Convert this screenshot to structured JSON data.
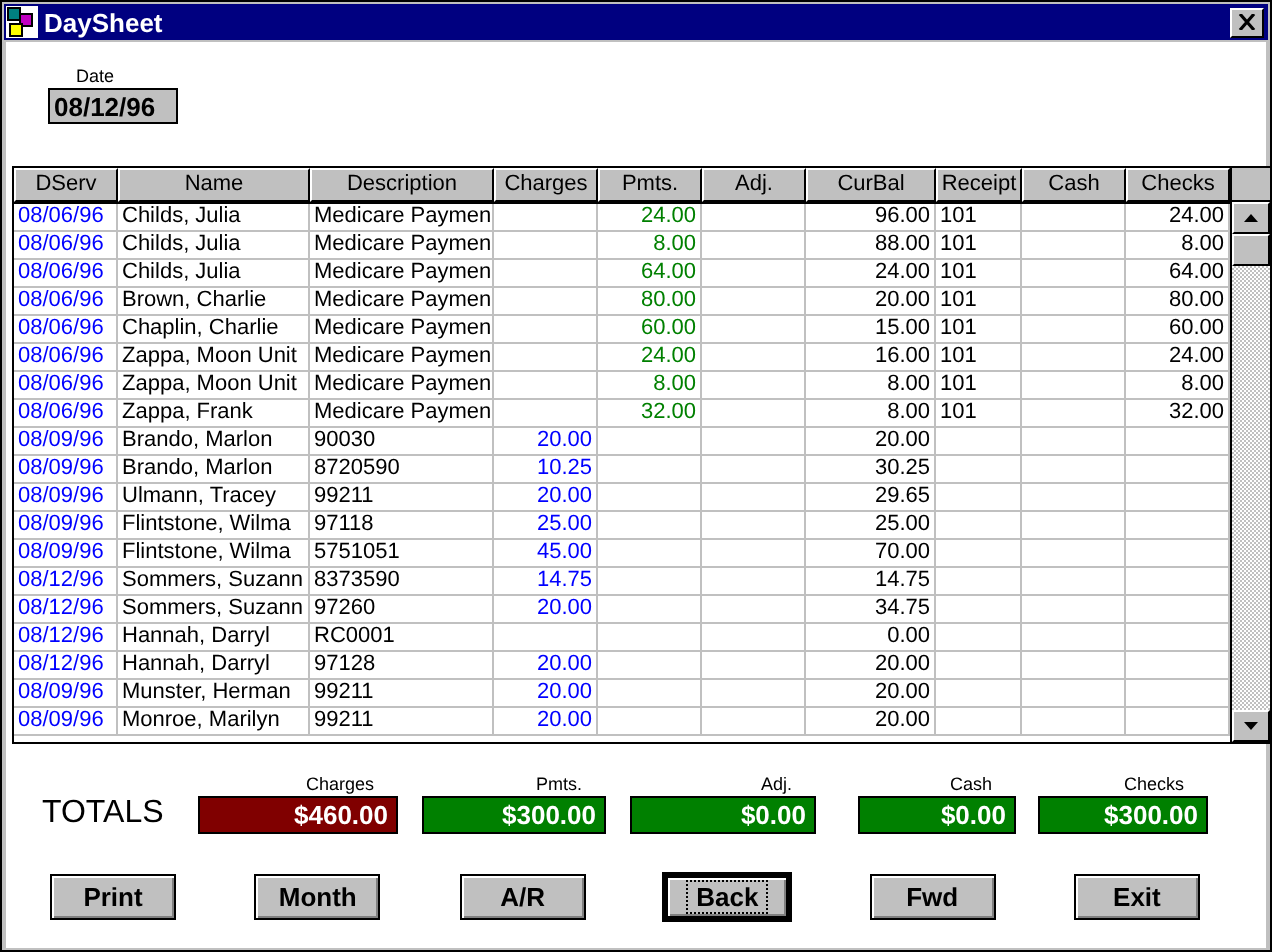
{
  "window": {
    "title": "DaySheet"
  },
  "date": {
    "label": "Date",
    "value": "08/12/96"
  },
  "table": {
    "columns": [
      "DServ",
      "Name",
      "Description",
      "Charges",
      "Pmts.",
      "Adj.",
      "CurBal",
      "Receipt",
      "Cash",
      "Checks"
    ],
    "rows": [
      {
        "dserv": "08/06/96",
        "name": "Childs, Julia",
        "description": "Medicare Paymen",
        "pmts": "24.00",
        "curbal": "96.00",
        "receipt": "101",
        "checks": "24.00"
      },
      {
        "dserv": "08/06/96",
        "name": "Childs, Julia",
        "description": "Medicare Paymen",
        "pmts": "8.00",
        "curbal": "88.00",
        "receipt": "101",
        "checks": "8.00"
      },
      {
        "dserv": "08/06/96",
        "name": "Childs, Julia",
        "description": "Medicare Paymen",
        "pmts": "64.00",
        "curbal": "24.00",
        "receipt": "101",
        "checks": "64.00"
      },
      {
        "dserv": "08/06/96",
        "name": "Brown, Charlie",
        "description": "Medicare Paymen",
        "pmts": "80.00",
        "curbal": "20.00",
        "receipt": "101",
        "checks": "80.00"
      },
      {
        "dserv": "08/06/96",
        "name": "Chaplin, Charlie",
        "description": "Medicare Paymen",
        "pmts": "60.00",
        "curbal": "15.00",
        "receipt": "101",
        "checks": "60.00"
      },
      {
        "dserv": "08/06/96",
        "name": "Zappa, Moon Unit",
        "description": "Medicare Paymen",
        "pmts": "24.00",
        "curbal": "16.00",
        "receipt": "101",
        "checks": "24.00"
      },
      {
        "dserv": "08/06/96",
        "name": "Zappa, Moon Unit",
        "description": "Medicare Paymen",
        "pmts": "8.00",
        "curbal": "8.00",
        "receipt": "101",
        "checks": "8.00"
      },
      {
        "dserv": "08/06/96",
        "name": "Zappa, Frank",
        "description": "Medicare Paymen",
        "pmts": "32.00",
        "curbal": "8.00",
        "receipt": "101",
        "checks": "32.00"
      },
      {
        "dserv": "08/09/96",
        "name": "Brando, Marlon",
        "description": "90030",
        "charges": "20.00",
        "curbal": "20.00"
      },
      {
        "dserv": "08/09/96",
        "name": "Brando, Marlon",
        "description": "8720590",
        "charges": "10.25",
        "curbal": "30.25"
      },
      {
        "dserv": "08/09/96",
        "name": "Ulmann, Tracey",
        "description": "99211",
        "charges": "20.00",
        "curbal": "29.65"
      },
      {
        "dserv": "08/09/96",
        "name": "Flintstone, Wilma",
        "description": "97118",
        "charges": "25.00",
        "curbal": "25.00"
      },
      {
        "dserv": "08/09/96",
        "name": "Flintstone, Wilma",
        "description": "5751051",
        "charges": "45.00",
        "curbal": "70.00"
      },
      {
        "dserv": "08/12/96",
        "name": "Sommers, Suzann",
        "description": "8373590",
        "charges": "14.75",
        "curbal": "14.75"
      },
      {
        "dserv": "08/12/96",
        "name": "Sommers, Suzann",
        "description": "97260",
        "charges": "20.00",
        "curbal": "34.75"
      },
      {
        "dserv": "08/12/96",
        "name": "Hannah, Darryl",
        "description": "RC0001",
        "curbal": "0.00"
      },
      {
        "dserv": "08/12/96",
        "name": "Hannah, Darryl",
        "description": "97128",
        "charges": "20.00",
        "curbal": "20.00"
      },
      {
        "dserv": "08/09/96",
        "name": "Munster, Herman",
        "description": "99211",
        "charges": "20.00",
        "curbal": "20.00"
      },
      {
        "dserv": "08/09/96",
        "name": "Monroe, Marilyn",
        "description": "99211",
        "charges": "20.00",
        "curbal": "20.00"
      }
    ]
  },
  "totals": {
    "label": "TOTALS",
    "items": [
      {
        "label": "Charges",
        "value": "$460.00",
        "color": "#800000"
      },
      {
        "label": "Pmts.",
        "value": "$300.00",
        "color": "#008000"
      },
      {
        "label": "Adj.",
        "value": "$0.00",
        "color": "#008000"
      },
      {
        "label": "Cash",
        "value": "$0.00",
        "color": "#008000"
      },
      {
        "label": "Checks",
        "value": "$300.00",
        "color": "#008000"
      }
    ]
  },
  "buttons": [
    {
      "label": "Print",
      "focused": false
    },
    {
      "label": "Month",
      "focused": false
    },
    {
      "label": "A/R",
      "focused": false
    },
    {
      "label": "Back",
      "focused": true
    },
    {
      "label": "Fwd",
      "focused": false
    },
    {
      "label": "Exit",
      "focused": false
    }
  ]
}
